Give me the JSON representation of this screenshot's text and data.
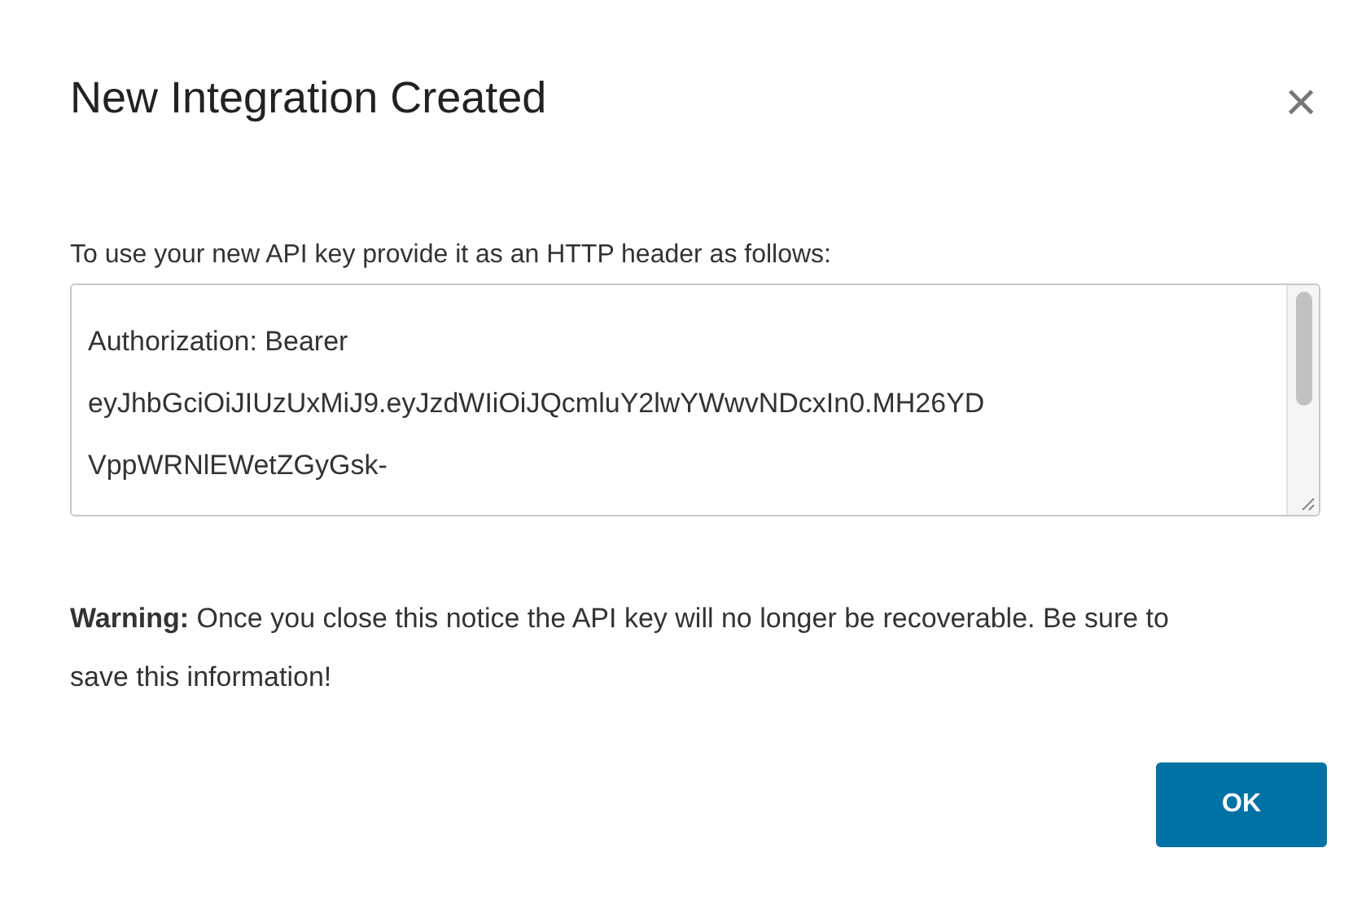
{
  "dialog": {
    "title": "New Integration Created",
    "close_glyph": "×"
  },
  "instructions": "To use your new API key provide it as an HTTP header as follows:",
  "key_field": {
    "lines": [
      "Authorization: Bearer",
      "eyJhbGciOiJIUzUxMiJ9.eyJzdWIiOiJQcmluY2lwYWwvNDcxIn0.MH26YD",
      "VppWRNlEWetZGyGsk-"
    ]
  },
  "warning": "**Warning:** Once you close this notice the API key will no longer be recoverable. Be sure to save this information!",
  "buttons": [
    {
      "label": "OK",
      "kind": "primary"
    }
  ]
}
